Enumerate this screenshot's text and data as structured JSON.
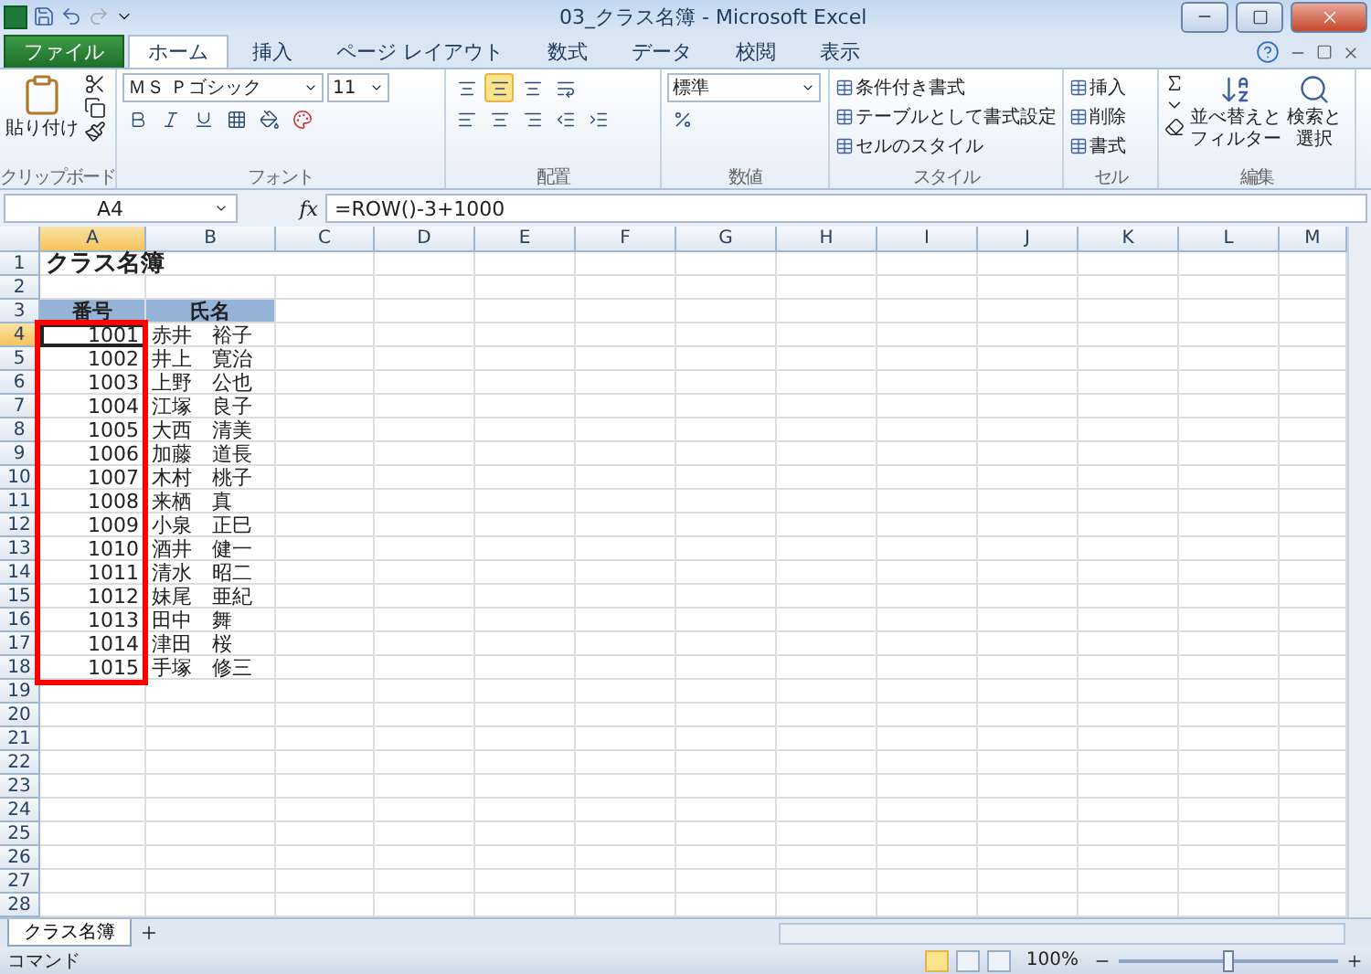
{
  "window": {
    "title": "03_クラス名簿 - Microsoft Excel"
  },
  "tabs": [
    {
      "label": "ファイル",
      "kind": "file",
      "selected": false
    },
    {
      "label": "ホーム",
      "kind": "tab",
      "selected": true
    },
    {
      "label": "挿入",
      "kind": "tab",
      "selected": false
    },
    {
      "label": "ページ レイアウト",
      "kind": "tab",
      "selected": false
    },
    {
      "label": "数式",
      "kind": "tab",
      "selected": false
    },
    {
      "label": "データ",
      "kind": "tab",
      "selected": false
    },
    {
      "label": "校閲",
      "kind": "tab",
      "selected": false
    },
    {
      "label": "表示",
      "kind": "tab",
      "selected": false
    }
  ],
  "ribbon": {
    "clipboard": {
      "paste": "貼り付け",
      "label": "クリップボード"
    },
    "font": {
      "name": "ＭＳ Ｐゴシック",
      "size": "11",
      "label": "フォント"
    },
    "alignment": {
      "vertical": [
        {
          "selected": false
        },
        {
          "selected": true
        },
        {
          "selected": false
        }
      ],
      "label": "配置"
    },
    "number": {
      "format": "標準",
      "label": "数値"
    },
    "styles": {
      "buttons": [
        "条件付き書式",
        "テーブルとして書式設定",
        "セルのスタイル"
      ],
      "label": "スタイル"
    },
    "cells": {
      "buttons": [
        "挿入",
        "削除",
        "書式"
      ],
      "label": "セル"
    },
    "editing": {
      "sort": [
        "並べ替えと",
        "フィルター"
      ],
      "find": [
        "検索と",
        "選択"
      ],
      "label": "編集"
    }
  },
  "formula_bar": {
    "name_box": "A4",
    "fx": "fx",
    "formula": "=ROW()-3+1000"
  },
  "columns": [
    {
      "label": "A",
      "selected": true
    },
    {
      "label": "B",
      "selected": false
    },
    {
      "label": "C",
      "selected": false
    },
    {
      "label": "D",
      "selected": false
    },
    {
      "label": "E",
      "selected": false
    },
    {
      "label": "F",
      "selected": false
    },
    {
      "label": "G",
      "selected": false
    },
    {
      "label": "H",
      "selected": false
    },
    {
      "label": "I",
      "selected": false
    },
    {
      "label": "J",
      "selected": false
    },
    {
      "label": "K",
      "selected": false
    },
    {
      "label": "L",
      "selected": false
    },
    {
      "label": "M",
      "selected": false
    }
  ],
  "row_numbers": [
    {
      "label": "1",
      "selected": false
    },
    {
      "label": "2",
      "selected": false
    },
    {
      "label": "3",
      "selected": false
    },
    {
      "label": "4",
      "selected": true
    },
    {
      "label": "5",
      "selected": false
    },
    {
      "label": "6",
      "selected": false
    },
    {
      "label": "7",
      "selected": false
    },
    {
      "label": "8",
      "selected": false
    },
    {
      "label": "9",
      "selected": false
    },
    {
      "label": "10",
      "selected": false
    },
    {
      "label": "11",
      "selected": false
    },
    {
      "label": "12",
      "selected": false
    },
    {
      "label": "13",
      "selected": false
    },
    {
      "label": "14",
      "selected": false
    },
    {
      "label": "15",
      "selected": false
    },
    {
      "label": "16",
      "selected": false
    },
    {
      "label": "17",
      "selected": false
    },
    {
      "label": "18",
      "selected": false
    },
    {
      "label": "19",
      "selected": false
    },
    {
      "label": "20",
      "selected": false
    },
    {
      "label": "21",
      "selected": false
    },
    {
      "label": "22",
      "selected": false
    },
    {
      "label": "23",
      "selected": false
    },
    {
      "label": "24",
      "selected": false
    },
    {
      "label": "25",
      "selected": false
    },
    {
      "label": "26",
      "selected": false
    },
    {
      "label": "27",
      "selected": false
    },
    {
      "label": "28",
      "selected": false
    }
  ],
  "sheet": {
    "title": "クラス名簿",
    "header": [
      "番号",
      "氏名"
    ],
    "records": [
      {
        "no": "1001",
        "name": "赤井　裕子",
        "selected": true
      },
      {
        "no": "1002",
        "name": "井上　寛治",
        "selected": false
      },
      {
        "no": "1003",
        "name": "上野　公也",
        "selected": false
      },
      {
        "no": "1004",
        "name": "江塚　良子",
        "selected": false
      },
      {
        "no": "1005",
        "name": "大西　清美",
        "selected": false
      },
      {
        "no": "1006",
        "name": "加藤　道長",
        "selected": false
      },
      {
        "no": "1007",
        "name": "木村　桃子",
        "selected": false
      },
      {
        "no": "1008",
        "name": "来栖　真",
        "selected": false
      },
      {
        "no": "1009",
        "name": "小泉　正巳",
        "selected": false
      },
      {
        "no": "1010",
        "name": "酒井　健一",
        "selected": false
      },
      {
        "no": "1011",
        "name": "清水　昭二",
        "selected": false
      },
      {
        "no": "1012",
        "name": "妹尾　亜紀",
        "selected": false
      },
      {
        "no": "1013",
        "name": "田中　舞",
        "selected": false
      },
      {
        "no": "1014",
        "name": "津田　桜",
        "selected": false
      },
      {
        "no": "1015",
        "name": "手塚　修三",
        "selected": false
      }
    ]
  },
  "sheet_tabs": [
    {
      "label": "クラス名簿",
      "selected": true
    }
  ],
  "status_bar": {
    "mode": "コマンド",
    "views": [
      {
        "selected": true
      },
      {
        "selected": false
      },
      {
        "selected": false
      }
    ],
    "zoom": "100%",
    "zoom_slider": {
      "level": 0.5
    }
  }
}
